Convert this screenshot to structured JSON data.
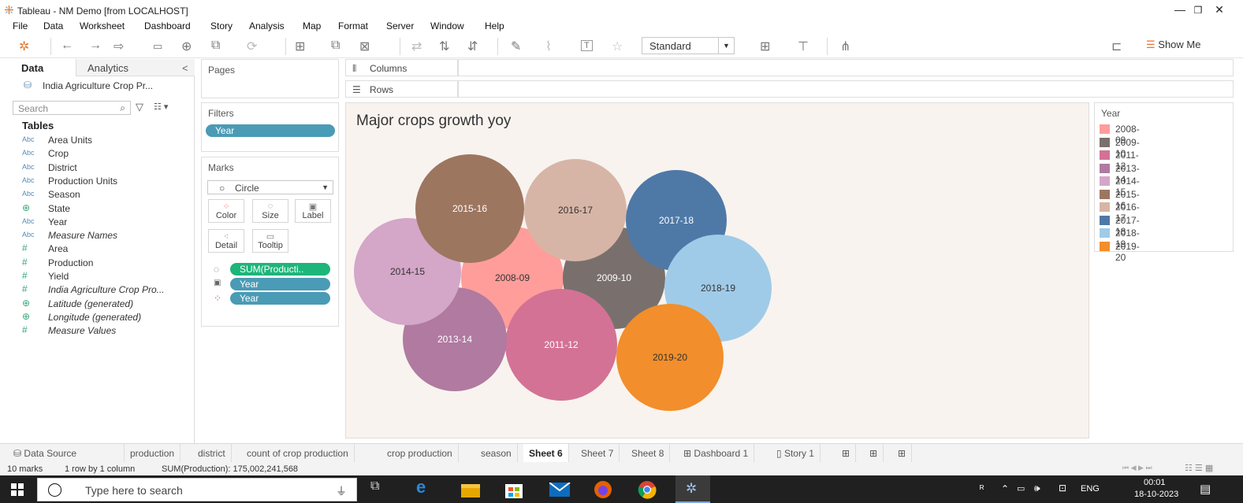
{
  "window": {
    "title": "Tableau - NM Demo [from LOCALHOST]"
  },
  "menu": [
    "File",
    "Data",
    "Worksheet",
    "Dashboard",
    "Story",
    "Analysis",
    "Map",
    "Format",
    "Server",
    "Window",
    "Help"
  ],
  "toolbar": {
    "fit_select": "Standard",
    "show_me": "Show Me"
  },
  "left_pane": {
    "tabs": [
      "Data",
      "Analytics"
    ],
    "datasource": "India Agriculture Crop Pr...",
    "search_placeholder": "Search",
    "tables_header": "Tables",
    "fields": [
      {
        "type": "Abc",
        "name": "Area Units",
        "italic": false
      },
      {
        "type": "Abc",
        "name": "Crop",
        "italic": false
      },
      {
        "type": "Abc",
        "name": "District",
        "italic": false
      },
      {
        "type": "Abc",
        "name": "Production Units",
        "italic": false
      },
      {
        "type": "Abc",
        "name": "Season",
        "italic": false
      },
      {
        "type": "globe",
        "name": "State",
        "italic": false
      },
      {
        "type": "Abc",
        "name": "Year",
        "italic": false
      },
      {
        "type": "Abc",
        "name": "Measure Names",
        "italic": true
      },
      {
        "type": "#",
        "name": "Area",
        "italic": false
      },
      {
        "type": "#",
        "name": "Production",
        "italic": false
      },
      {
        "type": "#",
        "name": "Yield",
        "italic": false
      },
      {
        "type": "#",
        "name": "India Agriculture Crop Pro...",
        "italic": true
      },
      {
        "type": "globe",
        "name": "Latitude (generated)",
        "italic": true
      },
      {
        "type": "globe",
        "name": "Longitude (generated)",
        "italic": true
      },
      {
        "type": "#",
        "name": "Measure Values",
        "italic": true
      }
    ]
  },
  "cards": {
    "pages": "Pages",
    "filters": "Filters",
    "filter_pill": "Year",
    "marks": "Marks",
    "mark_type": "Circle",
    "mark_buttons": [
      "Color",
      "Size",
      "Label",
      "Detail",
      "Tooltip"
    ],
    "mark_pills": [
      "SUM(Producti..",
      "Year",
      "Year"
    ]
  },
  "shelves": {
    "columns": "Columns",
    "rows": "Rows"
  },
  "viz": {
    "title": "Major crops growth yoy",
    "legend_title": "Year"
  },
  "chart_data": {
    "type": "packed-bubble",
    "title": "Major crops growth yoy",
    "size_measure": "SUM(Production)",
    "color_dimension": "Year",
    "series": [
      {
        "label": "2008-09",
        "color": "#ff9d9a",
        "text_color": "#333333"
      },
      {
        "label": "2009-10",
        "color": "#79706e",
        "text_color": "#ffffff"
      },
      {
        "label": "2011-12",
        "color": "#d37295",
        "text_color": "#ffffff"
      },
      {
        "label": "2013-14",
        "color": "#b07aa1",
        "text_color": "#ffffff"
      },
      {
        "label": "2014-15",
        "color": "#d4a6c8",
        "text_color": "#333333"
      },
      {
        "label": "2015-16",
        "color": "#9d7660",
        "text_color": "#ffffff"
      },
      {
        "label": "2016-17",
        "color": "#d7b5a6",
        "text_color": "#333333"
      },
      {
        "label": "2017-18",
        "color": "#4e79a7",
        "text_color": "#ffffff"
      },
      {
        "label": "2018-19",
        "color": "#a0cbe8",
        "text_color": "#333333"
      },
      {
        "label": "2019-20",
        "color": "#f28e2b",
        "text_color": "#333333"
      }
    ]
  },
  "sheet_tabs": [
    "Data Source",
    "production",
    "district",
    "count of crop production",
    "crop production",
    "season",
    "Sheet 6",
    "Sheet 7",
    "Sheet 8",
    "Dashboard 1",
    "Story 1"
  ],
  "active_tab": "Sheet 6",
  "status": {
    "marks": "10 marks",
    "rows": "1 row by 1 column",
    "sum": "SUM(Production): 175,002,241,568"
  },
  "taskbar": {
    "search_placeholder": "Type here to search",
    "lang": "ENG",
    "time": "00:01",
    "date": "18-10-2023"
  }
}
